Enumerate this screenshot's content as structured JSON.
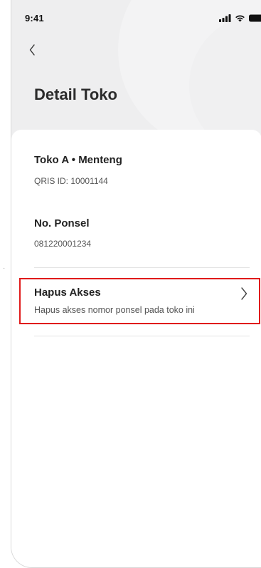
{
  "status_bar": {
    "time": "9:41",
    "icons": [
      "signal-icon",
      "wifi-icon",
      "battery-icon"
    ]
  },
  "header": {
    "back_icon": "chevron-left-icon",
    "title": "Detail Toko"
  },
  "store": {
    "name": "Toko A • Menteng",
    "qris_id": "QRIS ID: 10001144"
  },
  "phone": {
    "label": "No. Ponsel",
    "value": "081220001234"
  },
  "remove_access": {
    "title": "Hapus Akses",
    "description": "Hapus akses nomor ponsel pada toko ini",
    "icon": "chevron-right-icon"
  },
  "colors": {
    "header_background": "#eeeeef",
    "highlight_border": "#e01b1b",
    "text_primary": "#222222",
    "text_secondary": "#555555"
  }
}
